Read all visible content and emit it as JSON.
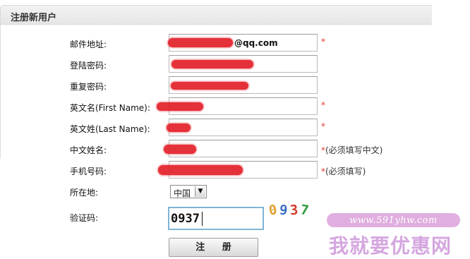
{
  "header": {
    "title": "注册新用户"
  },
  "form": {
    "email": {
      "label": "邮件地址:",
      "visible_value": "@qq.com",
      "required_mark": "*"
    },
    "password": {
      "label": "登陆密码:"
    },
    "confirm_password": {
      "label": "重复密码:"
    },
    "first_name": {
      "label": "英文名(First Name):",
      "required_mark": "*"
    },
    "last_name": {
      "label": "英文姓(Last Name):",
      "required_mark": "*"
    },
    "chinese_name": {
      "label": "中文姓名:",
      "note_star": "*",
      "note": "(必须填写中文)"
    },
    "phone": {
      "label": "手机号码:",
      "note_star": "*",
      "note": "(必须填写)"
    },
    "location": {
      "label": "所在地:",
      "selected": "中国",
      "arrow": "▼"
    },
    "captcha": {
      "label": "验证码:",
      "input_value": "0937",
      "image_digits": [
        "0",
        "9",
        "3",
        "7"
      ]
    },
    "submit_label": "注 册"
  },
  "colors": {
    "required": "#e23a2a",
    "redaction": "#e3202a",
    "captcha_digits": [
      "#e0a030",
      "#3a6fc2",
      "#d23a2a",
      "#2e9a3a"
    ]
  },
  "watermark": {
    "url": "www.591yhw.com",
    "text": "我就要优惠网"
  }
}
